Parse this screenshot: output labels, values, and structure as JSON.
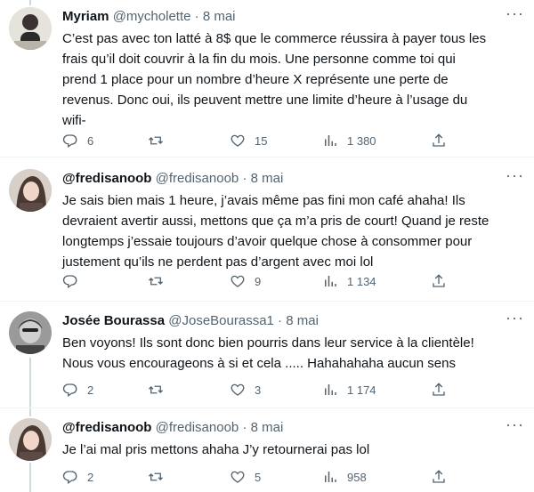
{
  "tweets": [
    {
      "name": "Myriam",
      "handle": "@mycholette",
      "dot": "·",
      "date": "8 mai",
      "text": "C’est pas avec ton latté à 8$ que le commerce réussira à payer tous les\nfrais qu’il doit couvrir à la fin du mois. Une personne comme toi qui\nprend 1 place pour un nombre d’heure X représente une perte de\nrevenus. Donc oui, ils peuvent mettre une limite d’heure à l’usage du\nwifi-",
      "replies": "6",
      "retweets": "",
      "likes": "15",
      "views": "1 380"
    },
    {
      "name": "@fredisanoob",
      "handle": "@fredisanoob",
      "dot": "·",
      "date": "8 mai",
      "text": "Je sais bien mais 1 heure, j’avais même pas fini mon café ahaha! Ils\ndevraient avertir aussi, mettons que ça m’a pris de court! Quand je reste\nlongtemps j’essaie toujours d’avoir quelque chose à consommer pour\njustement qu’ils ne perdent pas d’argent avec moi lol",
      "replies": "",
      "retweets": "",
      "likes": "9",
      "views": "1 134"
    },
    {
      "name": "Josée Bourassa",
      "handle": "@JoseBourassa1",
      "dot": "·",
      "date": "8 mai",
      "text": "Ben voyons! Ils sont donc bien pourris dans leur service à la clientèle!\nNous vous encourageons à si et cela ..... Hahahahaha aucun sens",
      "replies": "2",
      "retweets": "",
      "likes": "3",
      "views": "1 174"
    },
    {
      "name": "@fredisanoob",
      "handle": "@fredisanoob",
      "dot": "·",
      "date": "8 mai",
      "text": "Je l’ai mal pris mettons ahaha J’y retournerai pas lol",
      "replies": "2",
      "retweets": "",
      "likes": "5",
      "views": "958"
    }
  ],
  "icons": {
    "reply": "reply-icon",
    "retweet": "retweet-icon",
    "like": "like-icon",
    "views": "views-icon",
    "share": "share-icon",
    "more": "more-icon"
  },
  "colors": {
    "text": "#0f1419",
    "secondary": "#536471",
    "divider": "#eff3f4",
    "thread": "#cfd9de"
  }
}
